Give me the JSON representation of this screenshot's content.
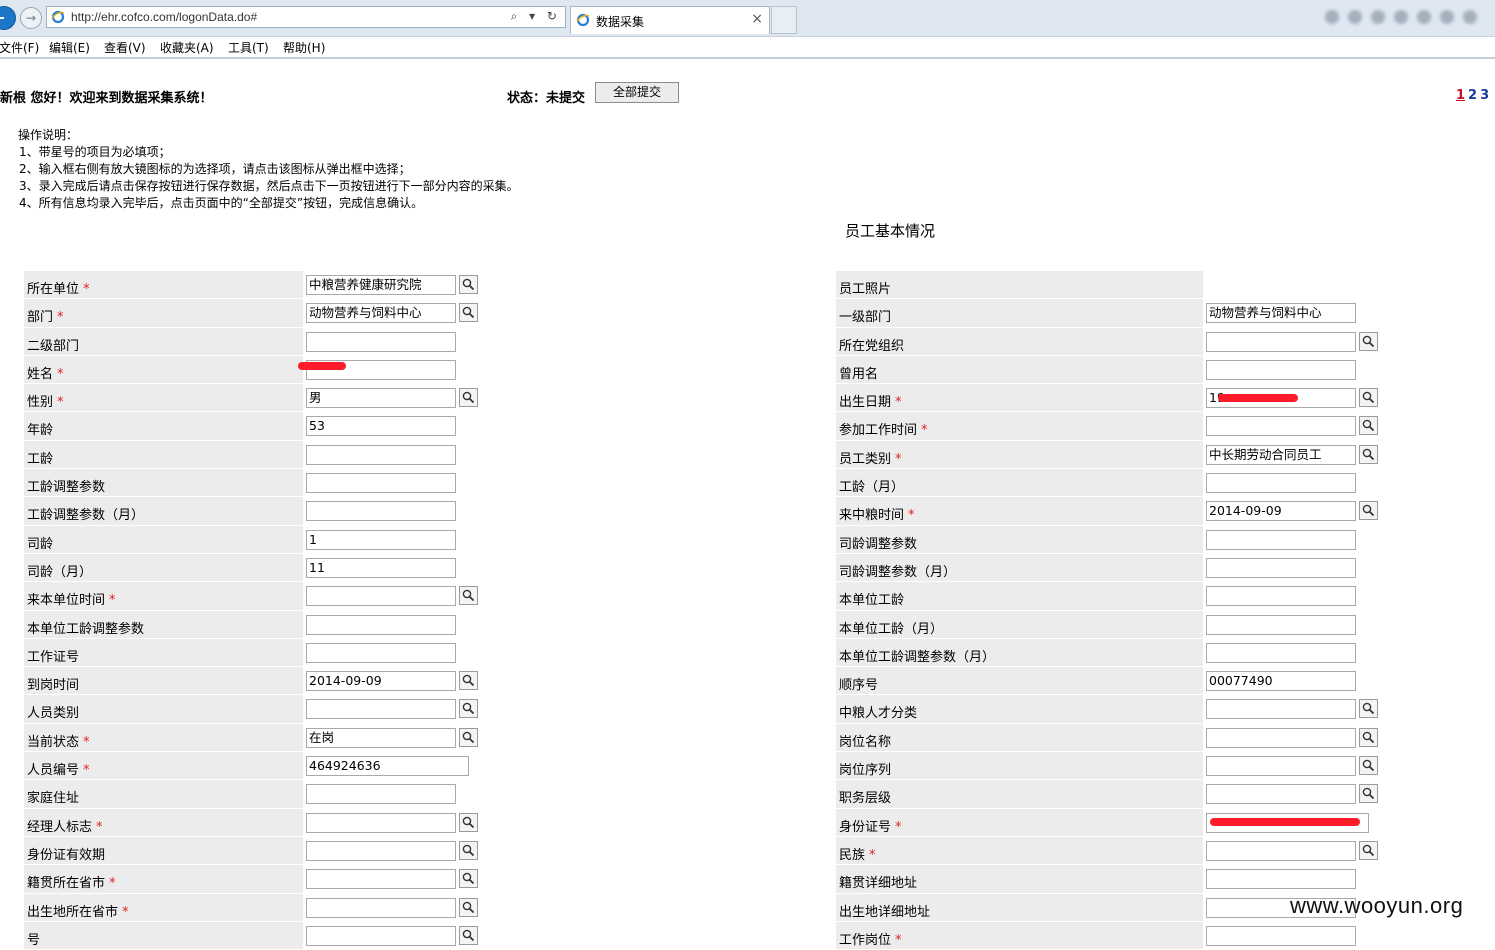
{
  "browser": {
    "url": "http://ehr.cofco.com/logonData.do#",
    "tab_title": "数据采集",
    "tab_close": "×",
    "forward_glyph": "→",
    "addr_controls": "⌕ ▾ ↻"
  },
  "menu": [
    "文件(F)",
    "编辑(E)",
    "查看(V)",
    "收藏夹(A)",
    "工具(T)",
    "帮助(H)"
  ],
  "header": {
    "greeting": "新根  您好！欢迎来到数据采集系统！",
    "status": "状态：未提交",
    "submit_all": "全部提交",
    "pages": [
      "1",
      "2",
      "3"
    ]
  },
  "instructions": {
    "title": "操作说明：",
    "lines": [
      "1、带星号的项目为必填项；",
      "2、输入框右侧有放大镜图标的为选择项，请点击该图标从弹出框中选择；",
      "3、录入完成后请点击保存按钮进行保存数据，然后点击下一页按钮进行下一部分内容的采集。",
      "4、所有信息均录入完毕后，点击页面中的“全部提交”按钮，完成信息确认。"
    ]
  },
  "section_title": "员工基本情况",
  "required_mark": "*",
  "rows": [
    {
      "l": "所在单位",
      "lr": true,
      "lv": "中粮营养健康研究院",
      "ls": true,
      "r": "员工照片",
      "rr": false,
      "rv": null,
      "rs": false
    },
    {
      "l": "部门",
      "lr": true,
      "lv": "动物营养与饲料中心",
      "ls": true,
      "r": "一级部门",
      "rr": false,
      "rv": "动物营养与饲料中心",
      "rs": false
    },
    {
      "l": "二级部门",
      "lr": false,
      "lv": "",
      "ls": false,
      "r": "所在党组织",
      "rr": false,
      "rv": "",
      "rs": true
    },
    {
      "l": "姓名",
      "lr": true,
      "lv": "",
      "ls": false,
      "r": "曾用名",
      "rr": false,
      "rv": "",
      "rs": false
    },
    {
      "l": "性别",
      "lr": true,
      "lv": "男",
      "ls": true,
      "r": "出生日期",
      "rr": true,
      "rv": "19",
      "rs": true
    },
    {
      "l": "年龄",
      "lr": false,
      "lv": "53",
      "ls": false,
      "r": "参加工作时间",
      "rr": true,
      "rv": "",
      "rs": true
    },
    {
      "l": "工龄",
      "lr": false,
      "lv": "",
      "ls": false,
      "r": "员工类别",
      "rr": true,
      "rv": "中长期劳动合同员工",
      "rs": true
    },
    {
      "l": "工龄调整参数",
      "lr": false,
      "lv": "",
      "ls": false,
      "r": "工龄（月）",
      "rr": false,
      "rv": "",
      "rs": false
    },
    {
      "l": "工龄调整参数（月）",
      "lr": false,
      "lv": "",
      "ls": false,
      "r": "来中粮时间",
      "rr": true,
      "rv": "2014-09-09",
      "rs": true
    },
    {
      "l": "司龄",
      "lr": false,
      "lv": "1",
      "ls": false,
      "r": "司龄调整参数",
      "rr": false,
      "rv": "",
      "rs": false
    },
    {
      "l": "司龄（月）",
      "lr": false,
      "lv": "11",
      "ls": false,
      "r": "司龄调整参数（月）",
      "rr": false,
      "rv": "",
      "rs": false
    },
    {
      "l": "来本单位时间",
      "lr": true,
      "lv": "",
      "ls": true,
      "r": "本单位工龄",
      "rr": false,
      "rv": "",
      "rs": false
    },
    {
      "l": "本单位工龄调整参数",
      "lr": false,
      "lv": "",
      "ls": false,
      "r": "本单位工龄（月）",
      "rr": false,
      "rv": "",
      "rs": false
    },
    {
      "l": "工作证号",
      "lr": false,
      "lv": "",
      "ls": false,
      "r": "本单位工龄调整参数（月）",
      "rr": false,
      "rv": "",
      "rs": false
    },
    {
      "l": "到岗时间",
      "lr": false,
      "lv": "2014-09-09",
      "ls": true,
      "r": "顺序号",
      "rr": false,
      "rv": "00077490",
      "rs": false
    },
    {
      "l": "人员类别",
      "lr": false,
      "lv": "",
      "ls": true,
      "r": "中粮人才分类",
      "rr": false,
      "rv": "",
      "rs": true
    },
    {
      "l": "当前状态",
      "lr": true,
      "lv": "在岗",
      "ls": true,
      "r": "岗位名称",
      "rr": false,
      "rv": "",
      "rs": true
    },
    {
      "l": "人员编号",
      "lr": true,
      "lv": "464924636",
      "ls": false,
      "lw": true,
      "r": "岗位序列",
      "rr": false,
      "rv": "",
      "rs": true
    },
    {
      "l": "家庭住址",
      "lr": false,
      "lv": "",
      "ls": false,
      "r": "职务层级",
      "rr": false,
      "rv": "",
      "rs": true
    },
    {
      "l": "经理人标志",
      "lr": true,
      "lv": "",
      "ls": true,
      "r": "身份证号",
      "rr": true,
      "rv": "",
      "rs": false,
      "rw": true
    },
    {
      "l": "身份证有效期",
      "lr": false,
      "lv": "",
      "ls": true,
      "r": "民族",
      "rr": true,
      "rv": "",
      "rs": true
    },
    {
      "l": "籍贯所在省市",
      "lr": true,
      "lv": "",
      "ls": true,
      "r": "籍贯详细地址",
      "rr": false,
      "rv": "",
      "rs": false
    },
    {
      "l": "出生地所在省市",
      "lr": true,
      "lv": "",
      "ls": true,
      "r": "出生地详细地址",
      "rr": false,
      "rv": "",
      "rs": false
    },
    {
      "l": "号",
      "lr": false,
      "lv": "",
      "ls": true,
      "r": "工作岗位",
      "rr": true,
      "rv": "",
      "rs": false
    }
  ],
  "watermark": "www.wooyun.org",
  "colors": {
    "label_bg": "#ececec",
    "required": "#e02020",
    "redaction": "#ff1c2a",
    "page_current": "#c8102e",
    "page_link": "#1a3a9a"
  }
}
